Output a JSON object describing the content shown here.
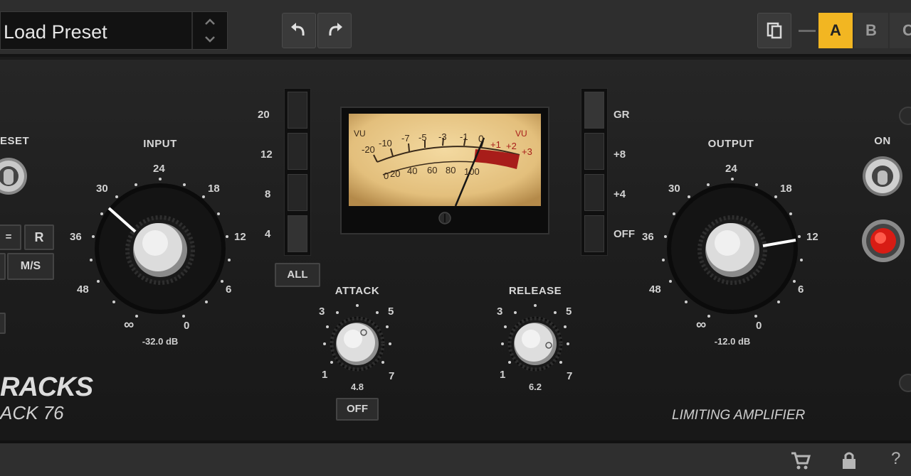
{
  "toolbar": {
    "preset_label": "Load Preset",
    "undo_icon": "undo-icon",
    "redo_icon": "redo-icon",
    "copy_icon": "copy-icon",
    "ab_slots": [
      "A",
      "B",
      "C"
    ],
    "active_slot": "A",
    "accent_color": "#f2b622"
  },
  "left_panel": {
    "preset_label": "ESET",
    "lr_label": "=",
    "r_label": "R",
    "ms_label": "M/S"
  },
  "input": {
    "label": "INPUT",
    "scale": [
      "24",
      "18",
      "12",
      "6",
      "0",
      "∞",
      "48",
      "36",
      "30"
    ],
    "value": "-32.0 dB"
  },
  "gr_meter_left": {
    "scale": [
      "20",
      "12",
      "8",
      "4"
    ],
    "all_label": "ALL"
  },
  "vu_meter": {
    "top_scale": [
      "VU",
      "-20",
      "-10",
      "-7",
      "-5",
      "-3",
      "-1",
      "0",
      "+1",
      "+2",
      "+3",
      "VU"
    ],
    "bottom_scale": [
      "0",
      "20",
      "40",
      "60",
      "80",
      "100"
    ]
  },
  "meter_selector": {
    "options": [
      "GR",
      "+8",
      "+4",
      "OFF"
    ]
  },
  "attack": {
    "label": "ATTACK",
    "scale": [
      "3",
      "5",
      "1",
      "7"
    ],
    "value": "4.8",
    "off_label": "OFF"
  },
  "release": {
    "label": "RELEASE",
    "scale": [
      "3",
      "5",
      "1",
      "7"
    ],
    "value": "6.2"
  },
  "output": {
    "label": "OUTPUT",
    "scale": [
      "24",
      "18",
      "12",
      "6",
      "0",
      "∞",
      "48",
      "36",
      "30"
    ],
    "value": "-12.0 dB"
  },
  "power": {
    "label": "ON"
  },
  "branding": {
    "logo": "RACKS",
    "model": "ACK 76",
    "subtitle": "LIMITING AMPLIFIER"
  },
  "footer": {
    "icons": [
      "cart-icon",
      "lock-icon",
      "help-icon"
    ],
    "help_glyph": "?"
  }
}
